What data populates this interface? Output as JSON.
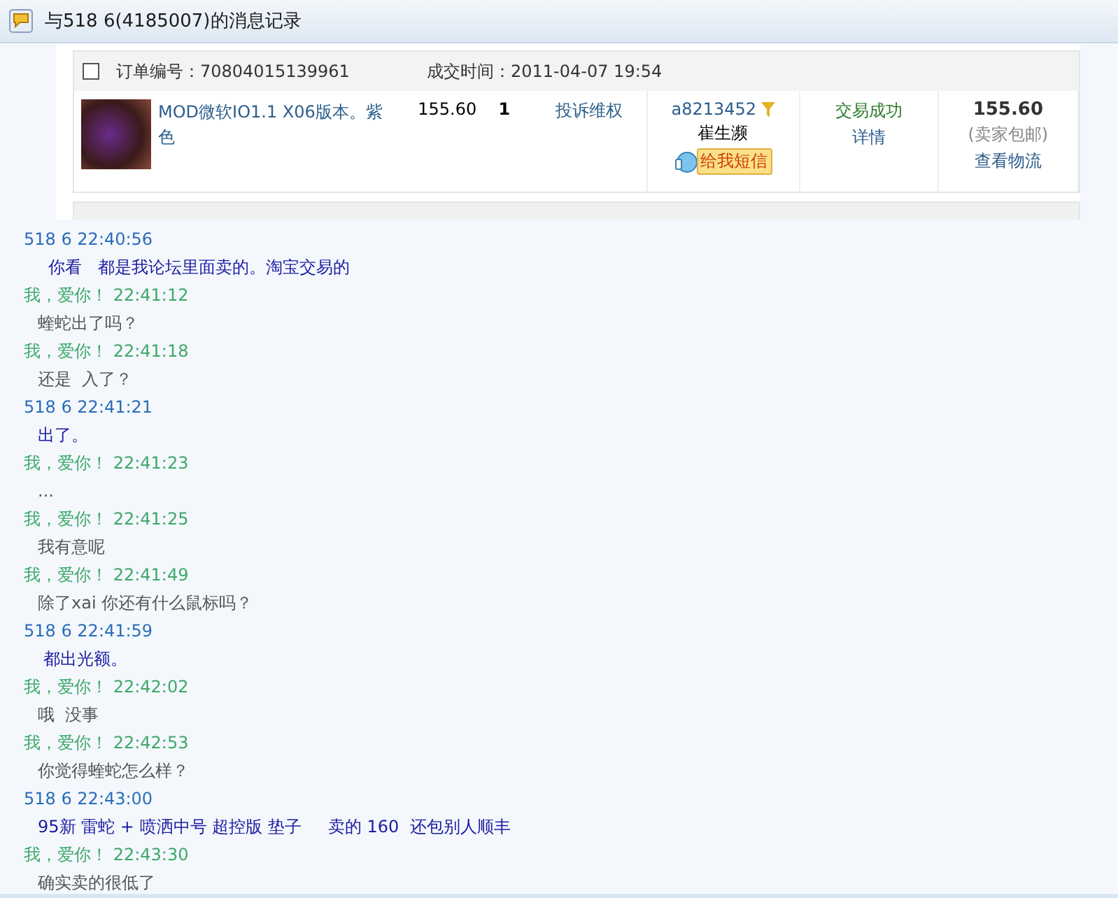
{
  "window": {
    "title": "与518 6(4185007)的消息记录"
  },
  "order": {
    "checked": false,
    "order_no": "订单编号：70804015139961",
    "deal_time": "成交时间：2011-04-07 19:54",
    "item_title": "MOD微软IO1.1 X06版本。紫色",
    "unit_price": "155.60",
    "quantity": "1",
    "complaint_link": "投诉维权",
    "seller_id": "a8213452",
    "seller_name": "崔生濒",
    "message_button": "给我短信",
    "status": "交易成功",
    "details_link": "详情",
    "total": "155.60",
    "shipping_note": "(卖家包邮)",
    "logistics_link": "查看物流"
  },
  "messages": [
    {
      "kind": "peer",
      "header": "518 6 22:40:56",
      "text": "  你看   都是我论坛里面卖的。淘宝交易的"
    },
    {
      "kind": "self",
      "header": "我，爱你！ 22:41:12",
      "text": "蝰蛇出了吗？"
    },
    {
      "kind": "self",
      "header": "我，爱你！ 22:41:18",
      "text": "还是  入了？"
    },
    {
      "kind": "peer",
      "header": "518 6 22:41:21",
      "text": "出了。"
    },
    {
      "kind": "self",
      "header": "我，爱你！ 22:41:23",
      "text": "..."
    },
    {
      "kind": "self",
      "header": "我，爱你！ 22:41:25",
      "text": "我有意呢"
    },
    {
      "kind": "self",
      "header": "我，爱你！ 22:41:49",
      "text": "除了xai 你还有什么鼠标吗？"
    },
    {
      "kind": "peer",
      "header": "518 6 22:41:59",
      "text": " 都出光额。"
    },
    {
      "kind": "self",
      "header": "我，爱你！ 22:42:02",
      "text": "哦  没事"
    },
    {
      "kind": "self",
      "header": "我，爱你！ 22:42:53",
      "text": "你觉得蝰蛇怎么样？"
    },
    {
      "kind": "peer",
      "header": "518 6 22:43:00",
      "text": "95新 雷蛇 + 喷洒中号 超控版 垫子     卖的 160  还包别人顺丰"
    },
    {
      "kind": "self",
      "header": "我，爱你！ 22:43:30",
      "text": "确实卖的很低了"
    }
  ]
}
